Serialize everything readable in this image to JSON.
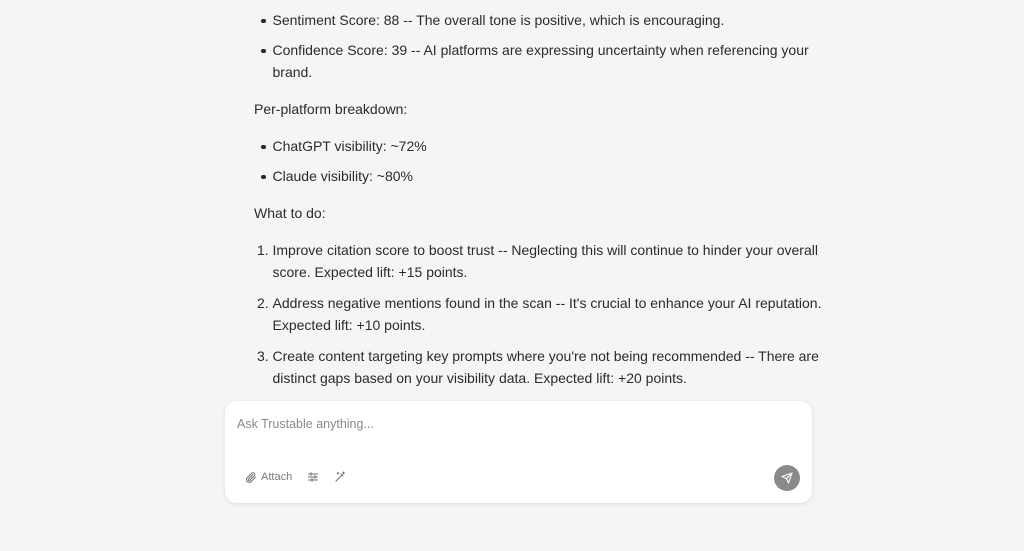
{
  "message": {
    "top_bullets": [
      "Sentiment Score: 88 -- The overall tone is positive, which is encouraging.",
      "Confidence Score: 39 -- AI platforms are expressing uncertainty when referencing your brand."
    ],
    "breakdown_heading": "Per-platform breakdown:",
    "platform_bullets": [
      "ChatGPT visibility: ~72%",
      "Claude visibility: ~80%"
    ],
    "actions_heading": "What to do:",
    "actions": [
      {
        "num": "1.",
        "text": "Improve citation score to boost trust -- Neglecting this will continue to hinder your overall score. Expected lift: +15 points."
      },
      {
        "num": "2.",
        "text": "Address negative mentions found in the scan -- It's crucial to enhance your AI reputation. Expected lift: +10 points."
      },
      {
        "num": "3.",
        "text": "Create content targeting key prompts where you're not being recommended -- There are distinct gaps based on your visibility data. Expected lift: +20 points."
      }
    ]
  },
  "composer": {
    "placeholder": "Ask Trustable anything...",
    "attach_label": "Attach",
    "icons": [
      "paperclip-icon",
      "sliders-icon",
      "magic-wand-icon",
      "send-icon"
    ]
  },
  "colors": {
    "background": "#f5f5f5",
    "text": "#2b2b2b",
    "send_button": "#8a8a8a",
    "muted": "#7a7a7a"
  }
}
